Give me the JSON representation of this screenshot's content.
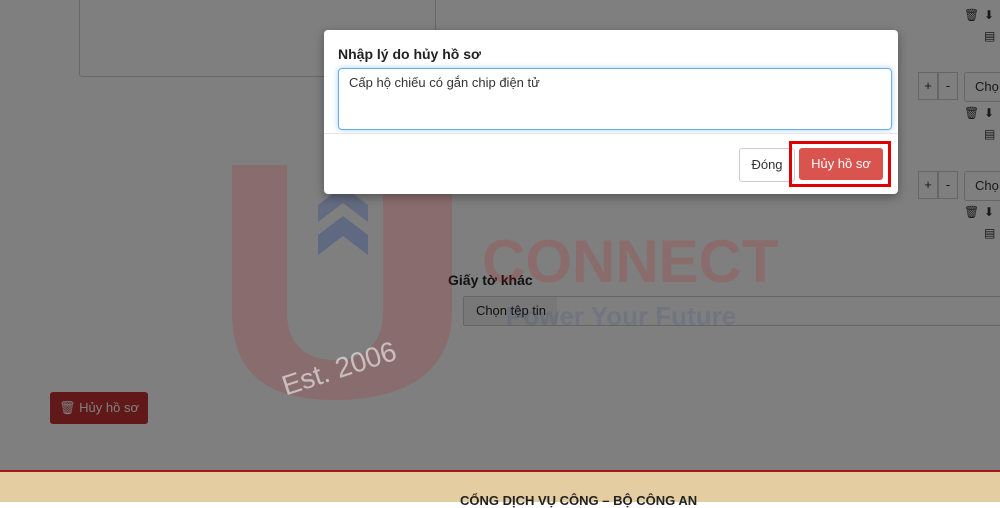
{
  "background": {
    "other_docs_label": "Giấy tờ khác",
    "choose_file_label": "Chọn tệp tin",
    "cancel_record_label": "Hủy hồ sơ",
    "select_stub_label": "Chọ",
    "plus_label": "+",
    "minus_label": "-",
    "footer_text": "CỔNG DỊCH VỤ CÔNG – BỘ CÔNG AN"
  },
  "watermark": {
    "brand": "CONNECT",
    "tagline": "Power Your Future",
    "est": "Est. 2006",
    "colors": {
      "red": "#c0151b",
      "blue": "#1e3a8a"
    }
  },
  "modal": {
    "title": "Nhập lý do hủy hồ sơ",
    "reason_value": "Cấp hộ chiếu có gắn chip điện tử",
    "close_label": "Đóng",
    "confirm_label": "Hủy hồ sơ",
    "colors": {
      "confirm": "#d9534f",
      "highlight": "#e00000"
    }
  },
  "icons": [
    "trash-icon",
    "download-icon",
    "file-icon"
  ]
}
